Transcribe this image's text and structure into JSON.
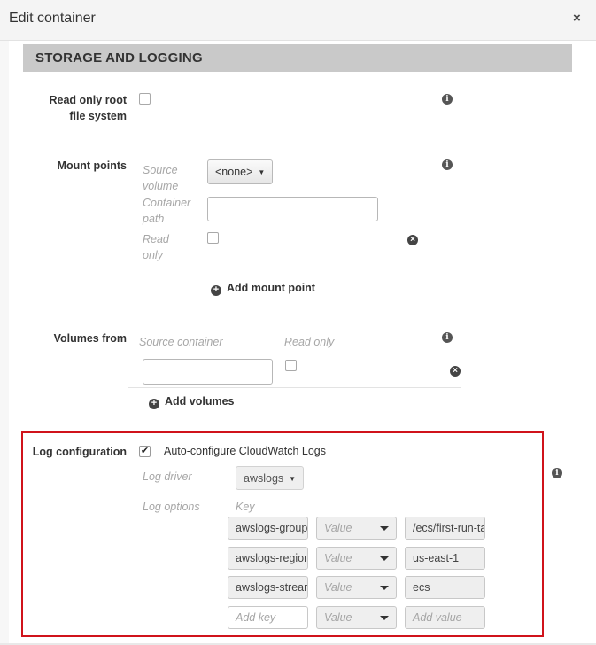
{
  "dialog": {
    "title": "Edit container",
    "close_icon": "×"
  },
  "section": {
    "title": "STORAGE AND LOGGING"
  },
  "readonly_root": {
    "label_line1": "Read only root",
    "label_line2": "file system",
    "checked": false
  },
  "mount_points": {
    "label": "Mount points",
    "source_volume_label_1": "Source",
    "source_volume_label_2": "volume",
    "source_volume_value": "<none>",
    "container_path_label_1": "Container",
    "container_path_label_2": "path",
    "container_path_value": "",
    "read_only_label_1": "Read",
    "read_only_label_2": "only",
    "add_label": "Add mount point"
  },
  "volumes_from": {
    "label": "Volumes from",
    "source_container_label": "Source container",
    "read_only_label": "Read only",
    "source_container_value": "",
    "add_label": "Add volumes"
  },
  "log_configuration": {
    "label": "Log configuration",
    "auto_configure_label": "Auto-configure CloudWatch Logs",
    "auto_configure_checked": true,
    "log_driver_label": "Log driver",
    "log_driver_value": "awslogs",
    "log_options_label": "Log options",
    "key_header": "Key",
    "options": [
      {
        "key": "awslogs-group",
        "value_type": "Value",
        "value": "/ecs/first-run-task-definition"
      },
      {
        "key": "awslogs-region",
        "value_type": "Value",
        "value": "us-east-1"
      },
      {
        "key": "awslogs-stream-prefix",
        "value_type": "Value",
        "value": "ecs"
      }
    ],
    "new_option": {
      "key_placeholder": "Add key",
      "value_type": "Value",
      "value_placeholder": "Add value"
    }
  },
  "icons": {
    "info": "i",
    "remove": "×",
    "add": "+",
    "checkmark": "✔",
    "caret": "▼"
  },
  "colors": {
    "highlight_border": "#d0131b",
    "section_header_bg": "#c9c9c9"
  }
}
